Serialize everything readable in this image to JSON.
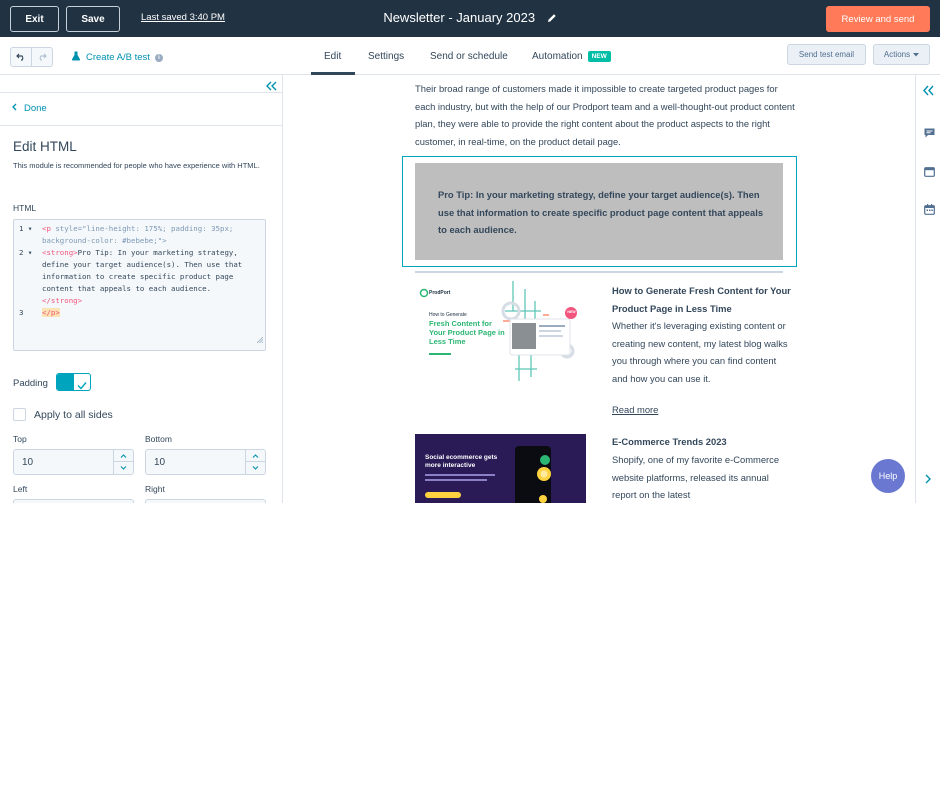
{
  "topbar": {
    "exit_label": "Exit",
    "save_label": "Save",
    "last_saved": "Last saved 3:40 PM",
    "doc_title": "Newsletter - January 2023",
    "review_label": "Review and send"
  },
  "subbar": {
    "ab_test_label": "Create A/B test",
    "tabs": [
      "Edit",
      "Settings",
      "Send or schedule",
      "Automation"
    ],
    "new_badge": "NEW",
    "send_test_label": "Send test email",
    "actions_label": "Actions"
  },
  "panel": {
    "done_label": "Done",
    "title": "Edit HTML",
    "description": "This module is recommended for people who have experience with HTML.",
    "html_label": "HTML",
    "line_numbers": [
      "1",
      "2",
      "3"
    ],
    "code": {
      "l1a_tag": "<p",
      "l1a_attr": " style=",
      "l1a_str": "\"line-height: 175%; padding: 35px;",
      "l1b": "background-color: #bebebe;\">",
      "l2_tag": "<strong>",
      "l2_text": "Pro Tip: In your marketing strategy,",
      "l2b": "define your target audience(s). Then use that",
      "l2c": "information to create specific product page",
      "l2d": "content that appeals to each audience.",
      "l2e": "</strong>",
      "l3": "</p>"
    },
    "padding_label": "Padding",
    "apply_all_label": "Apply to all sides",
    "top_label": "Top",
    "bottom_label": "Bottom",
    "left_label": "Left",
    "right_label": "Right",
    "top_value": "10",
    "bottom_value": "10"
  },
  "canvas": {
    "intro": "Their broad range of customers made it impossible to create targeted product pages for each industry, but with the help of our Prodport team and a well-thought-out product content plan, they were able to provide the right content about the product aspects to the right customer, in real-time, on the product detail page.",
    "tip": "Pro Tip: In your marketing strategy, define your target audience(s). Then use that information to create specific product page content that appeals to each audience.",
    "article1": {
      "image_brand": "ProdPort",
      "image_small": "How to Generate",
      "image_big": "Fresh Content for Your Product Page in Less Time",
      "image_badge": "NEW",
      "title": "How to Generate Fresh Content for Your Product Page in Less Time",
      "body": "Whether it's leveraging existing content or creating new content, my latest blog walks you through where you can find content and how you can use it.",
      "read_more": "Read more"
    },
    "article2": {
      "image_headline": "Social ecommerce gets more interactive",
      "title": "E-Commerce Trends 2023",
      "body": "Shopify, one of my favorite e-Commerce website platforms, released its annual report on the latest"
    }
  },
  "help_label": "Help",
  "colors": {
    "topbar": "#213343",
    "accent": "#ff7a59",
    "teal": "#00a4bd",
    "new_badge": "#00bda5",
    "help": "#6a78d1",
    "tip_bg": "#bebebe"
  }
}
